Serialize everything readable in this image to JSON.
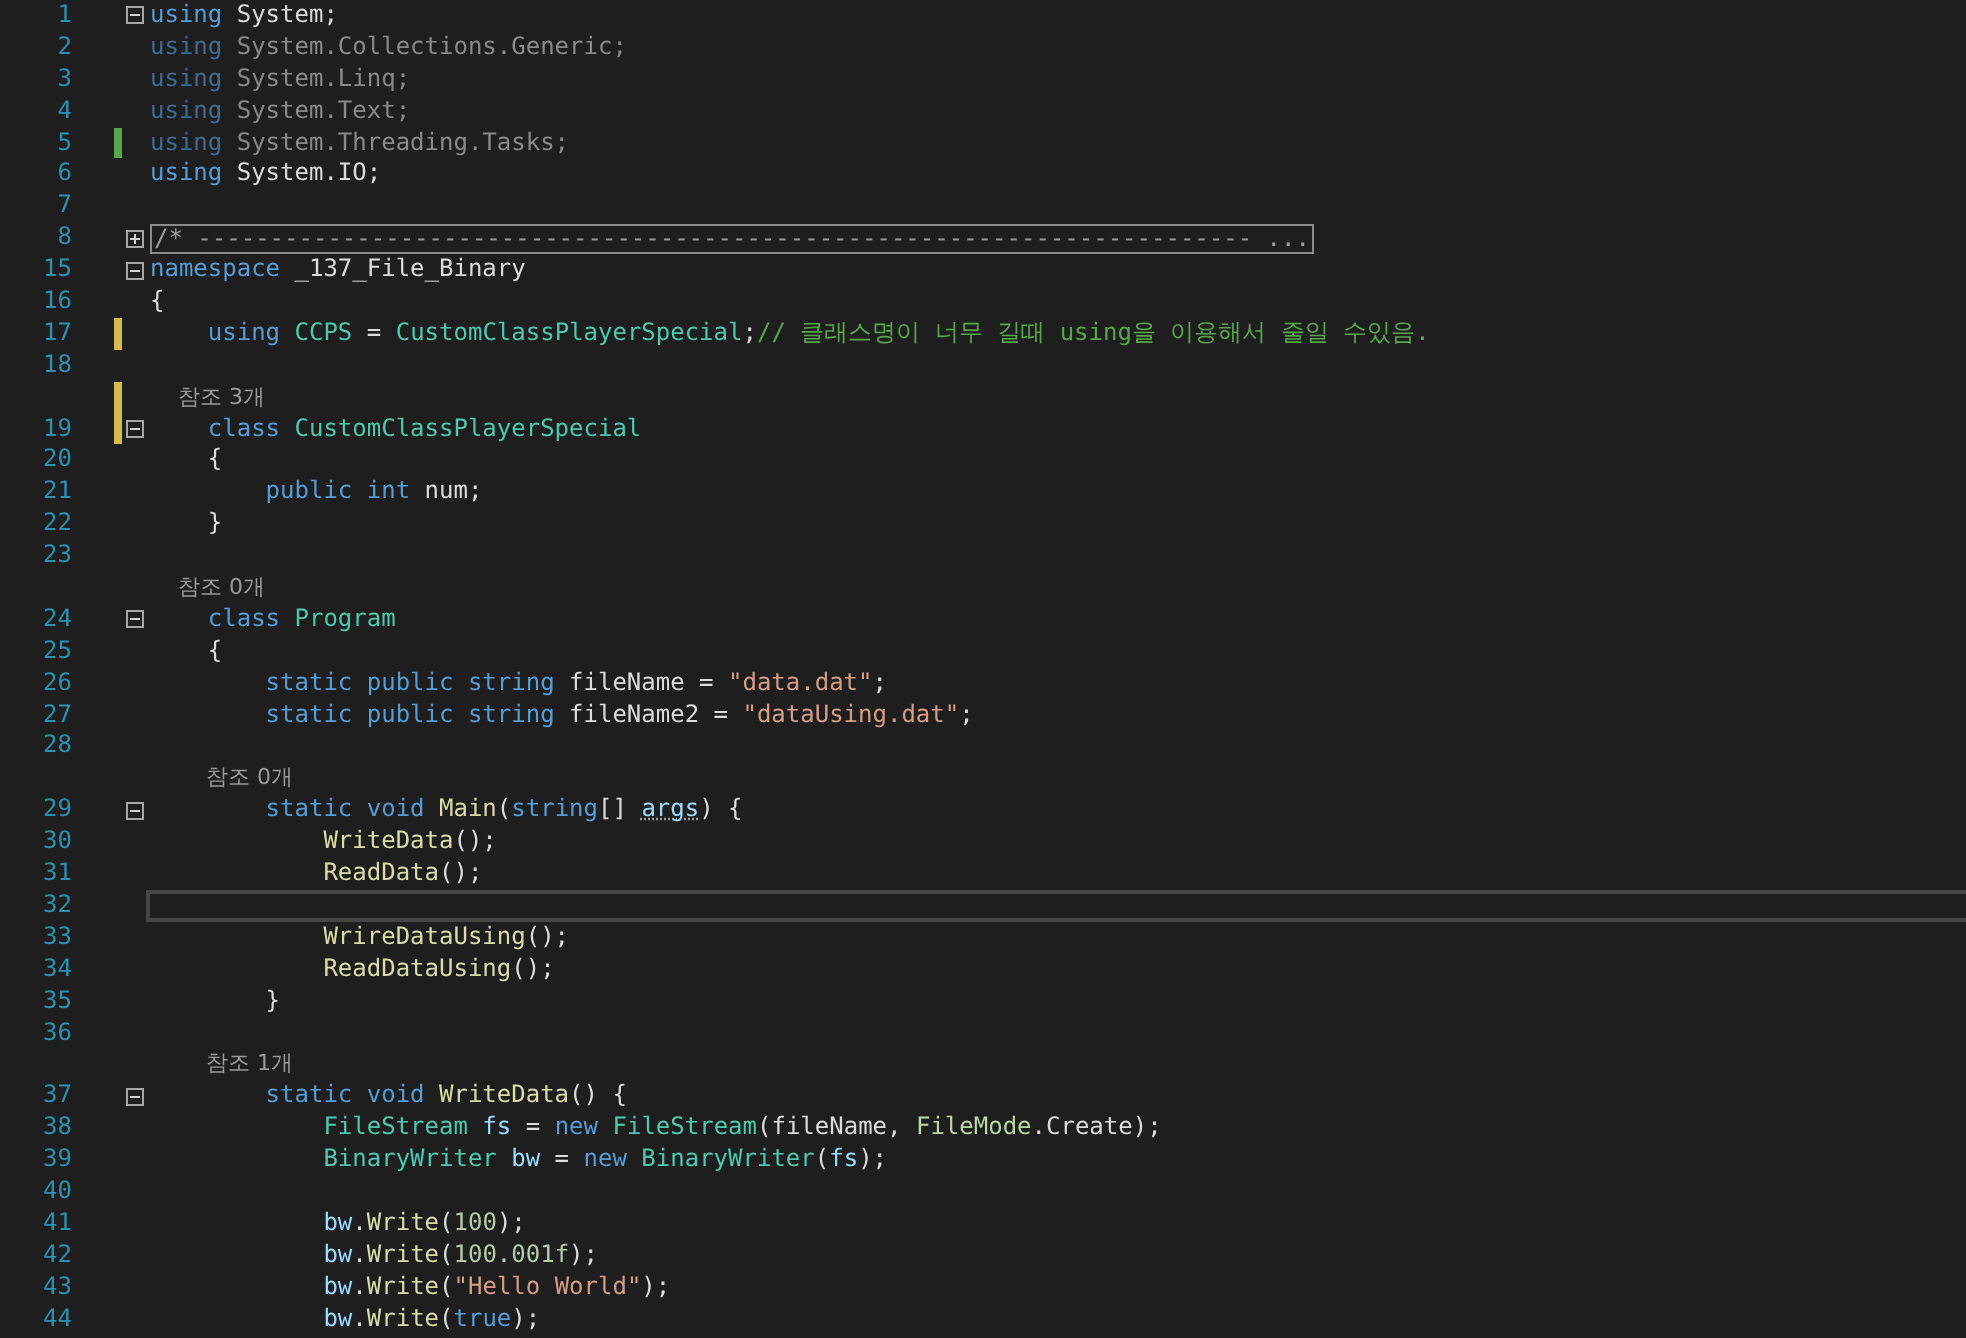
{
  "lines": [
    {
      "number": "1",
      "expanded": true,
      "tokens": [
        {
          "kind": "kw",
          "text": "using"
        },
        {
          "kind": "p",
          "text": " System;"
        }
      ]
    },
    {
      "number": "2",
      "tokens": [
        {
          "kind": "kd",
          "text": "using"
        },
        {
          "kind": "d",
          "text": " System.Collections.Generic;"
        }
      ]
    },
    {
      "number": "3",
      "tokens": [
        {
          "kind": "kd",
          "text": "using"
        },
        {
          "kind": "d",
          "text": " System.Linq;"
        }
      ]
    },
    {
      "number": "4",
      "tokens": [
        {
          "kind": "kd",
          "text": "using"
        },
        {
          "kind": "d",
          "text": " System.Text;"
        }
      ]
    },
    {
      "number": "5",
      "saved": true,
      "tokens": [
        {
          "kind": "kd",
          "text": "using"
        },
        {
          "kind": "d",
          "text": " System.Threading.Tasks;"
        }
      ]
    },
    {
      "number": "6",
      "tokens": [
        {
          "kind": "kw",
          "text": "using"
        },
        {
          "kind": "p",
          "text": " System.IO;"
        }
      ]
    },
    {
      "number": "7"
    },
    {
      "number": "8",
      "expanded": false,
      "tokens": [
        {
          "kind": "x",
          "text": "/* ------------------------------------------------------------------------- ..."
        }
      ]
    },
    {
      "number": "15",
      "expanded": true,
      "tokens": [
        {
          "kind": "kw",
          "text": "namespace"
        },
        {
          "kind": "p",
          "text": " _137_File_Binary"
        }
      ]
    },
    {
      "number": "16",
      "tokens": [
        {
          "kind": "p",
          "text": "{"
        }
      ]
    },
    {
      "number": "17",
      "saved": false,
      "tokens": [
        {
          "kind": "kw",
          "text": "    using"
        },
        {
          "kind": "t",
          "text": " CCPS"
        },
        {
          "kind": "p",
          "text": " = "
        },
        {
          "kind": "t",
          "text": "CustomClassPlayerSpecial"
        },
        {
          "kind": "p",
          "text": ";"
        },
        {
          "kind": "c",
          "text": "// 클래스명이 너무 길때 using을 이용해서 줄일 수있음."
        }
      ]
    },
    {
      "number": "18"
    },
    {
      "codelens": "    참조 3개",
      "saved": false
    },
    {
      "number": "19",
      "expanded": true,
      "saved": false,
      "tokens": [
        {
          "kind": "kw",
          "text": "    class"
        },
        {
          "kind": "t",
          "text": " CustomClassPlayerSpecial"
        }
      ]
    },
    {
      "number": "20",
      "tokens": [
        {
          "kind": "p",
          "text": "    {"
        }
      ]
    },
    {
      "number": "21",
      "tokens": [
        {
          "kind": "kw",
          "text": "        public"
        },
        {
          "kind": "kw",
          "text": " int"
        },
        {
          "kind": "p",
          "text": " num;"
        }
      ]
    },
    {
      "number": "22",
      "tokens": [
        {
          "kind": "p",
          "text": "    }"
        }
      ]
    },
    {
      "number": "23"
    },
    {
      "codelens": "    참조 0개"
    },
    {
      "number": "24",
      "expanded": true,
      "tokens": [
        {
          "kind": "kw",
          "text": "    class"
        },
        {
          "kind": "t",
          "text": " Program"
        }
      ]
    },
    {
      "number": "25",
      "tokens": [
        {
          "kind": "p",
          "text": "    {"
        }
      ]
    },
    {
      "number": "26",
      "tokens": [
        {
          "kind": "kw",
          "text": "        static public string"
        },
        {
          "kind": "p",
          "text": " fileName = "
        },
        {
          "kind": "s",
          "text": "\"data.dat\""
        },
        {
          "kind": "p",
          "text": ";"
        }
      ]
    },
    {
      "number": "27",
      "tokens": [
        {
          "kind": "kw",
          "text": "        static public string"
        },
        {
          "kind": "p",
          "text": " fileName2 = "
        },
        {
          "kind": "s",
          "text": "\"dataUsing.dat\""
        },
        {
          "kind": "p",
          "text": ";"
        }
      ]
    },
    {
      "number": "28"
    },
    {
      "codelens": "        참조 0개"
    },
    {
      "number": "29",
      "expanded": true,
      "tokens": [
        {
          "kind": "kw",
          "text": "        static void"
        },
        {
          "kind": "m",
          "text": " Main"
        },
        {
          "kind": "p",
          "text": "("
        },
        {
          "kind": "kw",
          "text": "string"
        },
        {
          "kind": "p",
          "text": "[] "
        },
        {
          "kind": "u",
          "text": "args"
        },
        {
          "kind": "p",
          "text": ") {"
        }
      ]
    },
    {
      "number": "30",
      "tokens": [
        {
          "kind": "m",
          "text": "            WriteData"
        },
        {
          "kind": "p",
          "text": "();"
        }
      ]
    },
    {
      "number": "31",
      "tokens": [
        {
          "kind": "m",
          "text": "            ReadData"
        },
        {
          "kind": "p",
          "text": "();"
        }
      ]
    },
    {
      "number": "32",
      "current": true
    },
    {
      "number": "33",
      "tokens": [
        {
          "kind": "m",
          "text": "            WrireDataUsing"
        },
        {
          "kind": "p",
          "text": "();"
        }
      ]
    },
    {
      "number": "34",
      "tokens": [
        {
          "kind": "m",
          "text": "            ReadDataUsing"
        },
        {
          "kind": "p",
          "text": "();"
        }
      ]
    },
    {
      "number": "35",
      "tokens": [
        {
          "kind": "p",
          "text": "        }"
        }
      ]
    },
    {
      "number": "36"
    },
    {
      "codelens": "        참조 1개"
    },
    {
      "number": "37",
      "expanded": true,
      "tokens": [
        {
          "kind": "kw",
          "text": "        static void"
        },
        {
          "kind": "m",
          "text": " WriteData"
        },
        {
          "kind": "p",
          "text": "() {"
        }
      ]
    },
    {
      "number": "38",
      "tokens": [
        {
          "kind": "t",
          "text": "            FileStream"
        },
        {
          "kind": "v",
          "text": " fs"
        },
        {
          "kind": "p",
          "text": " = "
        },
        {
          "kind": "kw",
          "text": "new"
        },
        {
          "kind": "t",
          "text": " FileStream"
        },
        {
          "kind": "p",
          "text": "(fileName, "
        },
        {
          "kind": "e",
          "text": "FileMode"
        },
        {
          "kind": "p",
          "text": ".Create);"
        }
      ]
    },
    {
      "number": "39",
      "tokens": [
        {
          "kind": "t",
          "text": "            BinaryWriter"
        },
        {
          "kind": "v",
          "text": " bw"
        },
        {
          "kind": "p",
          "text": " = "
        },
        {
          "kind": "kw",
          "text": "new"
        },
        {
          "kind": "t",
          "text": " BinaryWriter"
        },
        {
          "kind": "p",
          "text": "("
        },
        {
          "kind": "v",
          "text": "fs"
        },
        {
          "kind": "p",
          "text": ");"
        }
      ]
    },
    {
      "number": "40"
    },
    {
      "number": "41",
      "tokens": [
        {
          "kind": "v",
          "text": "            bw"
        },
        {
          "kind": "p",
          "text": "."
        },
        {
          "kind": "m",
          "text": "Write"
        },
        {
          "kind": "p",
          "text": "("
        },
        {
          "kind": "n",
          "text": "100"
        },
        {
          "kind": "p",
          "text": ");"
        }
      ]
    },
    {
      "number": "42",
      "tokens": [
        {
          "kind": "v",
          "text": "            bw"
        },
        {
          "kind": "p",
          "text": "."
        },
        {
          "kind": "m",
          "text": "Write"
        },
        {
          "kind": "p",
          "text": "("
        },
        {
          "kind": "n",
          "text": "100.001f"
        },
        {
          "kind": "p",
          "text": ");"
        }
      ]
    },
    {
      "number": "43",
      "tokens": [
        {
          "kind": "v",
          "text": "            bw"
        },
        {
          "kind": "p",
          "text": "."
        },
        {
          "kind": "m",
          "text": "Write"
        },
        {
          "kind": "p",
          "text": "("
        },
        {
          "kind": "s",
          "text": "\"Hello World\""
        },
        {
          "kind": "p",
          "text": ");"
        }
      ]
    },
    {
      "number": "44",
      "tokens": [
        {
          "kind": "v",
          "text": "            bw"
        },
        {
          "kind": "p",
          "text": "."
        },
        {
          "kind": "m",
          "text": "Write"
        },
        {
          "kind": "p",
          "text": "("
        },
        {
          "kind": "kw",
          "text": "true"
        },
        {
          "kind": "p",
          "text": ");"
        }
      ]
    }
  ]
}
